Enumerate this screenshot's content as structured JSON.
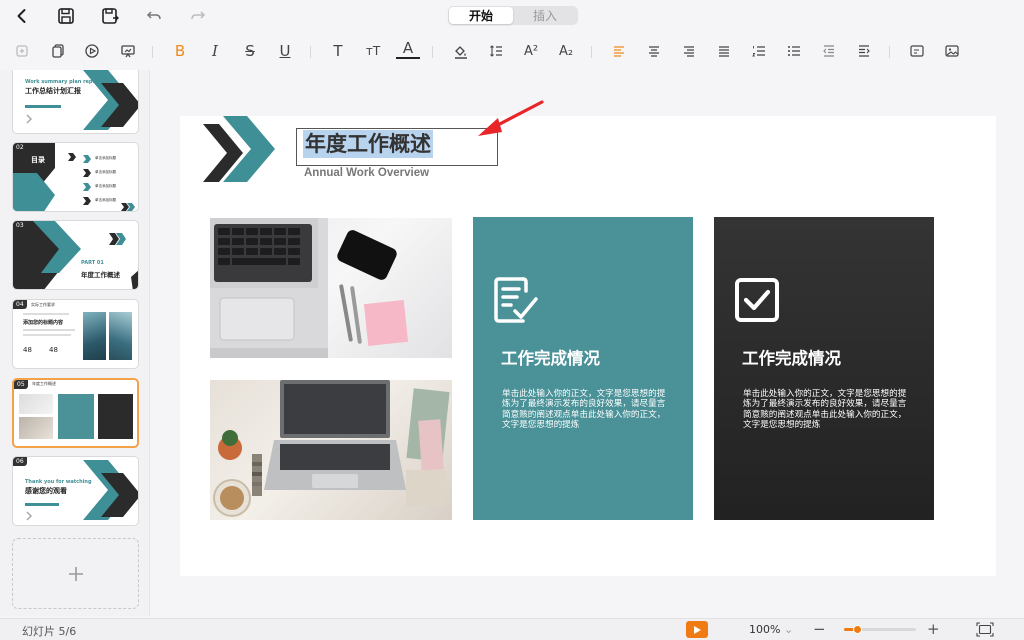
{
  "app": {
    "tabs": [
      {
        "label": "开始",
        "active": true
      },
      {
        "label": "插入",
        "active": false
      }
    ]
  },
  "slide": {
    "title": "年度工作概述",
    "subtitle": "Annual Work Overview",
    "cards": [
      {
        "title": "工作完成情况",
        "body": "单击此处输入你的正文，文字是您思想的提炼为了最终演示发布的良好效果，请尽量言简意赅的阐述观点单击此处输入你的正文，文字是您思想的提炼",
        "color": "#4a9198",
        "icon": "edit-document-icon"
      },
      {
        "title": "工作完成情况",
        "body": "单击此处输入你的正文，文字是您思想的提炼为了最终演示发布的良好效果，请尽量言简意赅的阐述观点单击此处输入你的正文，文字是您思想的提炼",
        "color": "#2b2b2b",
        "icon": "checkbox-icon"
      }
    ]
  },
  "thumbnails": {
    "t1": {
      "en": "Work summary plan report",
      "cn": "工作总结计划汇报"
    },
    "t2": {
      "num": "02",
      "cn": "目录",
      "items": [
        "单击添加标题",
        "单击添加标题",
        "单击添加标题",
        "单击添加标题"
      ]
    },
    "t3": {
      "num": "03",
      "part": "PART 01",
      "cn": "年度工作概述"
    },
    "t4": {
      "num": "04",
      "head": "实际工作要求",
      "sub": "添加您的标题内容",
      "nums": [
        "48",
        "48"
      ]
    },
    "t5": {
      "num": "05",
      "head": "年度工作概述"
    },
    "t6": {
      "num": "06",
      "en": "Thank you for watching",
      "cn": "感谢您的观看"
    }
  },
  "status": {
    "slide_counter": "幻灯片 5/6",
    "zoom": "100%",
    "zoom_fraction": 0.18
  },
  "colors": {
    "accent": "#f07a13",
    "teal": "#4a9198",
    "dark": "#2b2b2b",
    "selection": "#b8d3ee"
  }
}
